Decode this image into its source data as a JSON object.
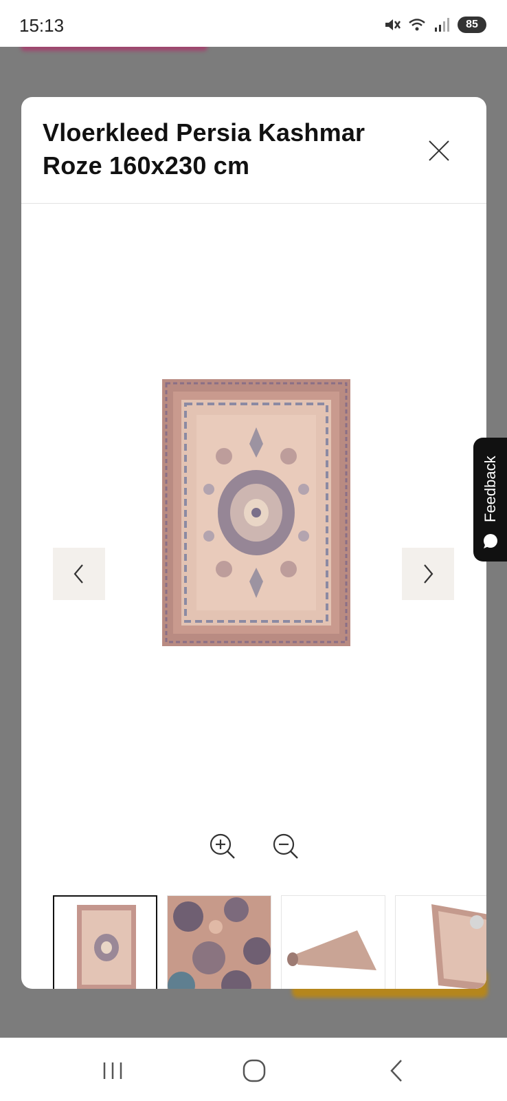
{
  "status_bar": {
    "time": "15:13",
    "battery": "85",
    "icons": [
      "mute-icon",
      "wifi-icon",
      "signal-icon"
    ]
  },
  "modal": {
    "title": "Vloerkleed Persia Kashmar Roze 160x230 cm",
    "main_image_alt": "rug-main-photo",
    "thumbnails": [
      {
        "name": "thumbnail-rug-full",
        "active": true
      },
      {
        "name": "thumbnail-rug-closeup",
        "active": false
      },
      {
        "name": "thumbnail-rug-rolled",
        "active": false
      },
      {
        "name": "thumbnail-rug-angle",
        "active": false
      }
    ]
  },
  "feedback": {
    "label": "Feedback"
  },
  "colors": {
    "backdrop": "#7c7c7c",
    "rug_field": "#d9b4a3",
    "rug_border": "#b88e84",
    "rug_pattern": "#6e6a82",
    "nav_btn_bg": "#f3f0ec",
    "feedback_bg": "#111111"
  }
}
